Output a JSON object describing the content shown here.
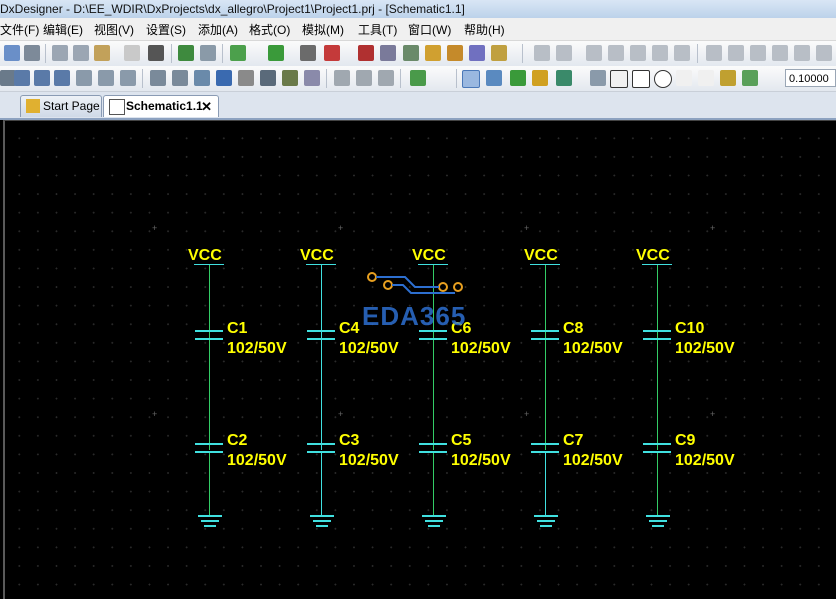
{
  "window": {
    "title": "DxDesigner - D:\\EE_WDIR\\DxProjects\\dx_allegro\\Project1\\Project1.prj - [Schematic1.1]"
  },
  "menu": [
    "文件(F)",
    "编辑(E)",
    "视图(V)",
    "设置(S)",
    "添加(A)",
    "格式(O)",
    "模拟(M)",
    "工具(T)",
    "窗口(W)",
    "帮助(H)"
  ],
  "toolbar": {
    "grid_value": "0.10000"
  },
  "tabs": [
    {
      "label": "Start Page"
    },
    {
      "label": "Schematic1.1",
      "close": "✕"
    }
  ],
  "schematic": {
    "power_label": "VCC",
    "columns": [
      {
        "top": {
          "ref": "C1",
          "value": "102/50V"
        },
        "bottom": {
          "ref": "C2",
          "value": "102/50V"
        }
      },
      {
        "top": {
          "ref": "C4",
          "value": "102/50V"
        },
        "bottom": {
          "ref": "C3",
          "value": "102/50V"
        }
      },
      {
        "top": {
          "ref": "C6",
          "value": "102/50V"
        },
        "bottom": {
          "ref": "C5",
          "value": "102/50V"
        }
      },
      {
        "top": {
          "ref": "C8",
          "value": "102/50V"
        },
        "bottom": {
          "ref": "C7",
          "value": "102/50V"
        }
      },
      {
        "top": {
          "ref": "C10",
          "value": "102/50V"
        },
        "bottom": {
          "ref": "C9",
          "value": "102/50V"
        }
      }
    ],
    "watermark": "EDA365"
  },
  "colors": {
    "label": "#ffff00",
    "wire": "#33cc66",
    "component": "#40e0e0",
    "background": "#000000"
  }
}
